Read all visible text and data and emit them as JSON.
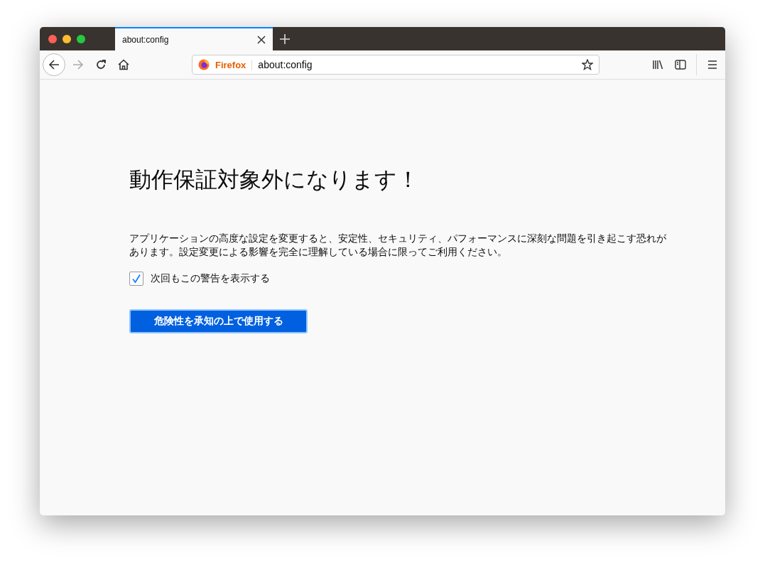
{
  "tabs": [
    {
      "label": "about:config",
      "selected": true
    }
  ],
  "toolbar": {
    "identity": "Firefox",
    "url": "about:config"
  },
  "page": {
    "title": "動作保証対象外になります！",
    "message": "アプリケーションの高度な設定を変更すると、安定性、セキュリティ、パフォーマンスに深刻な問題を引き起こす恐れがあります。設定変更による影響を完全に理解している場合に限ってご利用ください。",
    "checkbox": {
      "label": "次回もこの警告を表示する",
      "checked": true
    },
    "button": "危険性を承知の上で使用する"
  }
}
